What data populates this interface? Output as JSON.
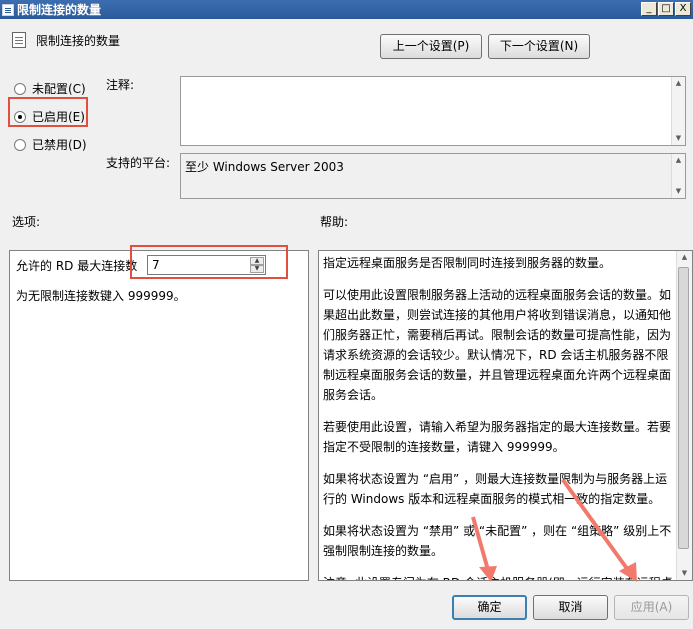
{
  "window": {
    "title": "限制连接的数量",
    "buttons": {
      "minimize": "_",
      "maximize": "□",
      "close": "X"
    }
  },
  "header": {
    "policy_name": "限制连接的数量",
    "prev_setting": "上一个设置(P)",
    "next_setting": "下一个设置(N)"
  },
  "state": {
    "not_configured": "未配置(C)",
    "enabled": "已启用(E)",
    "disabled": "已禁用(D)",
    "selected": "enabled"
  },
  "comment": {
    "label": "注释:",
    "value": ""
  },
  "supported": {
    "label": "支持的平台:",
    "value": "至少 Windows Server 2003"
  },
  "options": {
    "label": "选项:",
    "max_connections_label": "允许的 RD 最大连接数",
    "max_connections_value": "7",
    "hint": "为无限制连接数键入 999999。"
  },
  "help": {
    "label": "帮助:",
    "paragraphs": [
      "指定远程桌面服务是否限制同时连接到服务器的数量。",
      "可以使用此设置限制服务器上活动的远程桌面服务会话的数量。如果超出此数量，则尝试连接的其他用户将收到错误消息，以通知他们服务器正忙，需要稍后再试。限制会话的数量可提高性能，因为请求系统资源的会话较少。默认情况下，RD 会话主机服务器不限制远程桌面服务会话的数量，并且管理远程桌面允许两个远程桌面服务会话。",
      "若要使用此设置，请输入希望为服务器指定的最大连接数量。若要指定不受限制的连接数量，请键入 999999。",
      "如果将状态设置为 “启用” ，则最大连接数量限制为与服务器上运行的 Windows 版本和远程桌面服务的模式相一致的指定数量。",
      "如果将状态设置为 “禁用” 或 “未配置” ，则在 “组策略” 级别上不强制限制连接的数量。",
      "注意: 此设置专门为在 RD 会话主机服务器(即，运行安装有远程桌"
    ]
  },
  "footer": {
    "ok": "确定",
    "cancel": "取消",
    "apply": "应用(A)"
  },
  "colors": {
    "title_bar": "#2a5a9c",
    "highlight": "#e05040",
    "arrow": "#f27a6c"
  }
}
